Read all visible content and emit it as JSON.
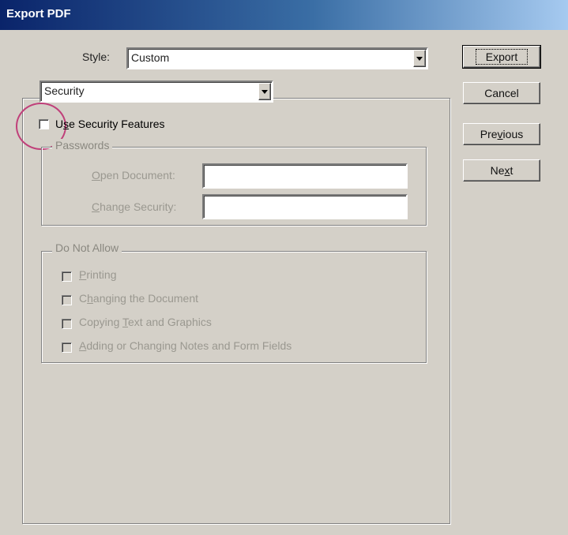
{
  "window": {
    "title": "Export PDF"
  },
  "style": {
    "label": "Style:",
    "value": "Custom"
  },
  "section_select": {
    "value": "Security"
  },
  "buttons": {
    "export": "Export",
    "cancel": "Cancel",
    "previous_pre": "Pre",
    "previous_u": "v",
    "previous_post": "ious",
    "next_pre": "Ne",
    "next_u": "x",
    "next_post": "t"
  },
  "security": {
    "use_security_pre": "U",
    "use_security_u": "s",
    "use_security_post": "e Security Features",
    "use_security_checked": false
  },
  "passwords": {
    "title": "Passwords",
    "open_document_u": "O",
    "open_document_post": "pen Document:",
    "open_document_value": "",
    "change_security_u": "C",
    "change_security_post": "hange Security:",
    "change_security_value": ""
  },
  "do_not_allow": {
    "title": "Do Not Allow",
    "items": [
      {
        "pre": "",
        "u": "P",
        "post": "rinting",
        "checked": false
      },
      {
        "pre": "C",
        "u": "h",
        "post": "anging the Document",
        "checked": false
      },
      {
        "pre": "Copying ",
        "u": "T",
        "post": "ext and Graphics",
        "checked": false
      },
      {
        "pre": "",
        "u": "A",
        "post": "dding or Changing Notes and Form Fields",
        "checked": false
      }
    ]
  },
  "colors": {
    "accent_circle": "#c0407a",
    "title_bar": "#0a246a"
  }
}
